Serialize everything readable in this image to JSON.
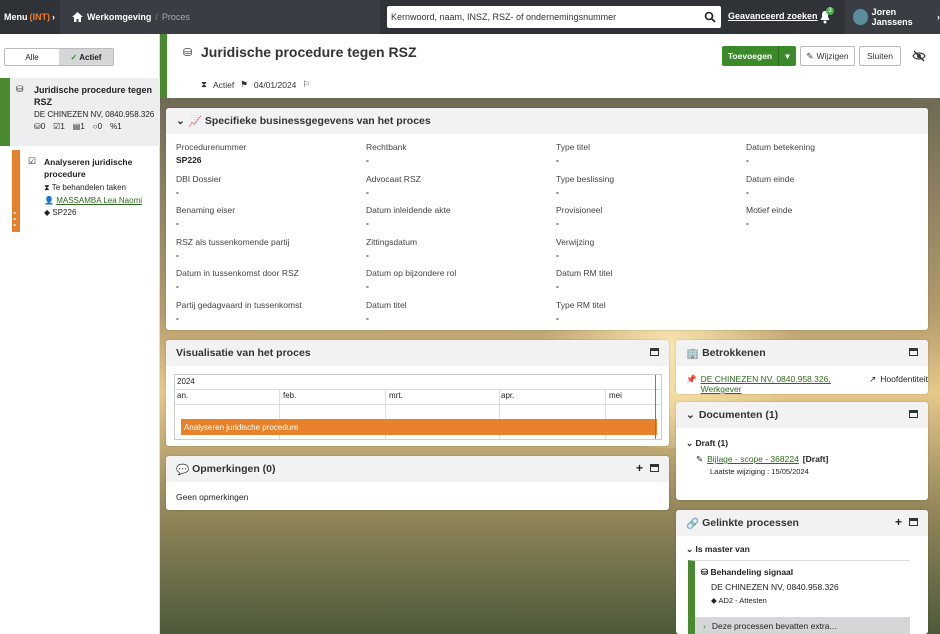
{
  "topbar": {
    "menu_label": "Menu",
    "env_label": "(INT)",
    "home_label": "Werkomgeving",
    "separator": "/",
    "current_crumb": "Proces",
    "search_placeholder": "Kernwoord, naam, INSZ, RSZ- of ondernemingsnummer",
    "advanced_search": "Geavanceerd zoeken",
    "notification_count": "3",
    "user_name": "Joren Janssens"
  },
  "left": {
    "filter_all": "Alle",
    "filter_active": "Actief",
    "card1": {
      "title": "Juridische procedure tegen RSZ",
      "subtitle": "DE CHINEZEN NV, 0840.958.326",
      "stats": [
        "0",
        "1",
        "1",
        "0",
        "1"
      ]
    },
    "card2": {
      "title": "Analyseren juridische procedure",
      "status": "Te behandelen taken",
      "assignee": "MASSAMBA Lea Naomi",
      "tag": "SP226"
    }
  },
  "header": {
    "title": "Juridische procedure tegen RSZ",
    "status": "Actief",
    "date": "04/01/2024",
    "add_button": "Toevoegen",
    "edit_button": "Wijzigen",
    "close_button": "Sluiten"
  },
  "business": {
    "title": "Specifieke businessgegevens van het proces",
    "fields": [
      {
        "label": "Procedurenummer",
        "value": "SP226"
      },
      {
        "label": "Rechtbank",
        "value": "-"
      },
      {
        "label": "Type titel",
        "value": "-"
      },
      {
        "label": "Datum betekening",
        "value": "-"
      },
      {
        "label": "DBI Dossier",
        "value": "-"
      },
      {
        "label": "Advocaat RSZ",
        "value": "-"
      },
      {
        "label": "Type beslissing",
        "value": "-"
      },
      {
        "label": "Datum einde",
        "value": "-"
      },
      {
        "label": "Benaming eiser",
        "value": "-"
      },
      {
        "label": "Datum inleidende akte",
        "value": "-"
      },
      {
        "label": "Provisioneel",
        "value": "-"
      },
      {
        "label": "Motief einde",
        "value": "-"
      },
      {
        "label": "RSZ als tussenkomende partij",
        "value": "-"
      },
      {
        "label": "Zittingsdatum",
        "value": "-"
      },
      {
        "label": "Verwijzing",
        "value": "-"
      },
      {
        "label": "Datum in tussenkomst door RSZ",
        "value": "-"
      },
      {
        "label": "Datum op bijzondere rol",
        "value": "-"
      },
      {
        "label": "Datum RM titel",
        "value": "-"
      },
      {
        "label": "Partij gedagvaard in tussenkomst",
        "value": "-"
      },
      {
        "label": "Datum titel",
        "value": "-"
      },
      {
        "label": "Type RM titel",
        "value": "-"
      }
    ]
  },
  "visual": {
    "title": "Visualisatie van het proces",
    "year": "2024",
    "months": [
      "an.",
      "feb.",
      "mrt.",
      "apr.",
      "mei"
    ],
    "bar_label": "Analyseren juridische procedure"
  },
  "remarks": {
    "title": "Opmerkingen (0)",
    "empty": "Geen opmerkingen"
  },
  "involved": {
    "title": "Betrokkenen",
    "link": "DE CHINEZEN NV, 0840.958.326, Werkgever",
    "role": "Hoofdentiteit"
  },
  "documents": {
    "title": "Documenten (1)",
    "group": "Draft (1)",
    "doc_link": "Bijlage - scope - 368224",
    "doc_badge": "[Draft]",
    "doc_modified": "Laatste wijziging : 15/05/2024"
  },
  "linked": {
    "title": "Gelinkte processen",
    "group": "Is master van",
    "item_title": "Behandeling signaal",
    "item_sub": "DE CHINEZEN NV, 0840.958.326",
    "item_tag": "AD2 - Attesten",
    "more": "Deze processen bevatten extra..."
  },
  "colors": {
    "topbar": "#2f3338",
    "green": "#3a8a2a",
    "orange": "#e8822a",
    "env": "#f07d22"
  }
}
